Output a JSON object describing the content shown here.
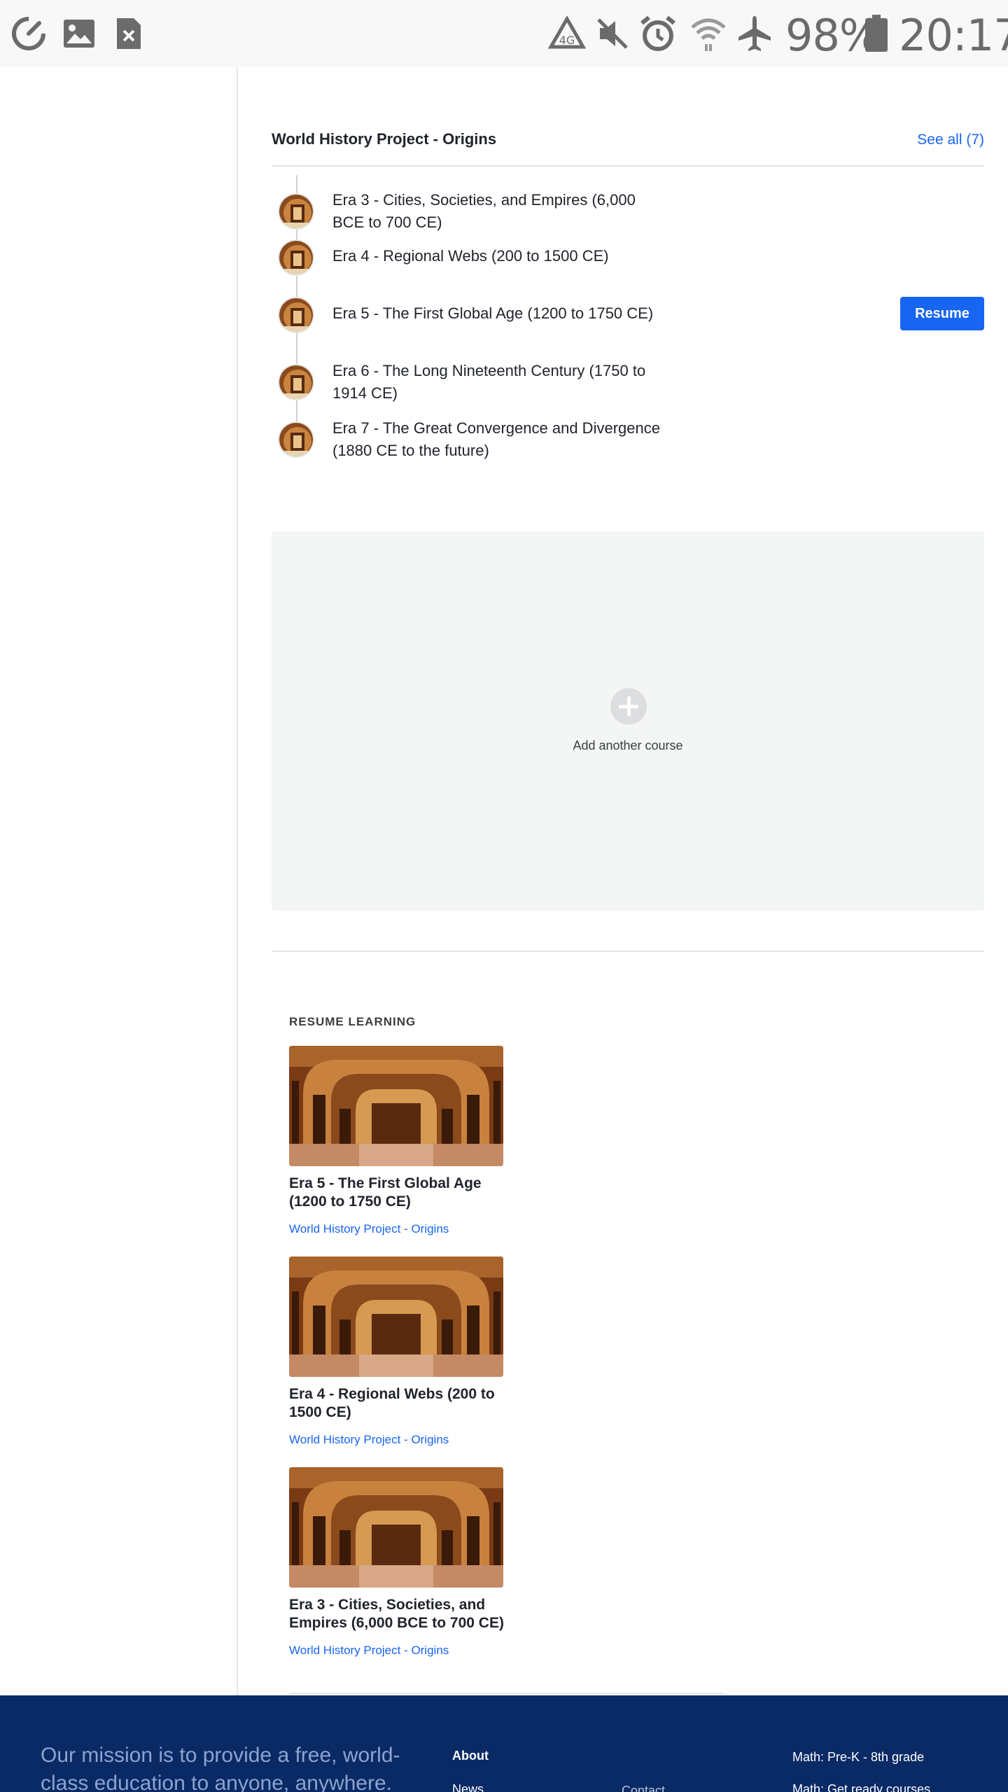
{
  "status_bar": {
    "battery": "98%",
    "time": "20:17",
    "icons": [
      "speedometer-icon",
      "image-icon",
      "file-close-icon",
      "recycle-icon",
      "mute-icon",
      "alarm-icon",
      "wifi-icon",
      "airplane-icon",
      "battery-icon"
    ]
  },
  "course_card": {
    "title": "World History Project - Origins",
    "see_all": "See all (7)",
    "units": [
      {
        "label": "Era 3 - Cities, Societies, and Empires (6,000 BCE to 700 CE)"
      },
      {
        "label": "Era 4 - Regional Webs (200 to 1500 CE)"
      },
      {
        "label": "Era 5 - The First Global Age (1200 to 1750 CE)",
        "action": "Resume"
      },
      {
        "label": "Era 6 - The Long Nineteenth Century (1750 to 1914 CE)"
      },
      {
        "label": "Era 7 - The Great Convergence and Divergence (1880 CE to the future)"
      }
    ]
  },
  "add_course": {
    "label": "Add another course"
  },
  "resume_learning": {
    "heading": "RESUME LEARNING",
    "items": [
      {
        "title": "Era 5 - The First Global Age (1200 to 1750 CE)",
        "course": "World History Project - Origins"
      },
      {
        "title": "Era 4 - Regional Webs (200 to 1500 CE)",
        "course": "World History Project - Origins"
      },
      {
        "title": "Era 3 - Cities, Societies, and Empires (6,000 BCE to 700 CE)",
        "course": "World History Project - Origins"
      }
    ]
  },
  "footer": {
    "mission": "Our mission is to provide a free, world-class education to anyone, anywhere.",
    "about": "About",
    "news": "News",
    "contact": "Contact",
    "math_prek": "Math: Pre-K - 8th grade",
    "math_ready": "Math: Get ready courses"
  },
  "colors": {
    "accent": "#1865f2",
    "footer_bg": "#0a2a66",
    "add_course_bg": "#f4f5f5"
  }
}
